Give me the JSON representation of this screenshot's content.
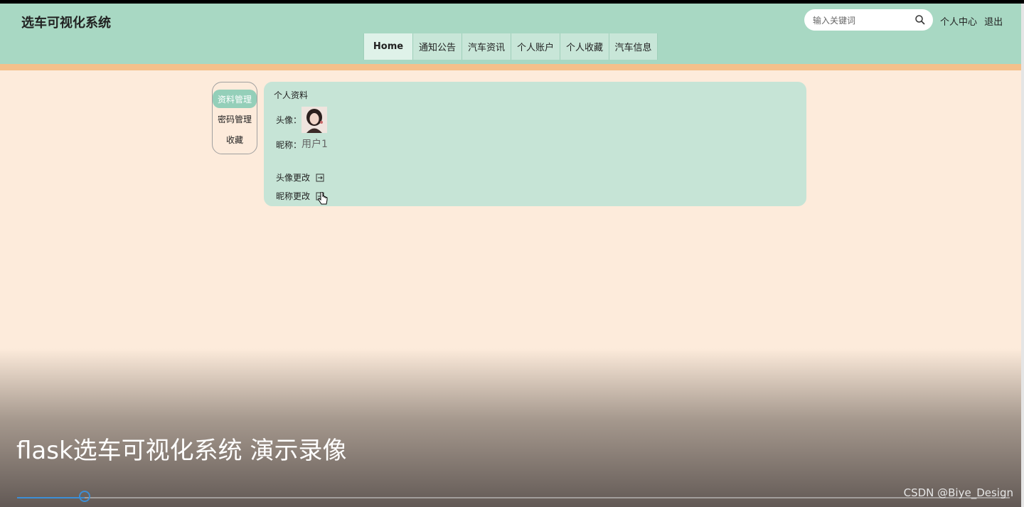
{
  "header": {
    "site_title": "选车可视化系统",
    "search_placeholder": "输入关键词",
    "user_center": "个人中心",
    "logout": "退出"
  },
  "nav": {
    "items": [
      {
        "label": "Home"
      },
      {
        "label": "通知公告"
      },
      {
        "label": "汽车资讯"
      },
      {
        "label": "个人账户"
      },
      {
        "label": "个人收藏"
      },
      {
        "label": "汽车信息"
      }
    ]
  },
  "sidebar": {
    "items": [
      {
        "label": "资料管理"
      },
      {
        "label": "密码管理"
      },
      {
        "label": "收藏"
      }
    ]
  },
  "profile": {
    "title": "个人资料",
    "avatar_label": "头像：",
    "nickname_label": "昵称：",
    "nickname_value": "用户1",
    "change_avatar": "头像更改",
    "change_nickname": "昵称更改"
  },
  "video": {
    "title": "flask选车可视化系统 演示录像",
    "progress_fraction": 0.068,
    "watermark": "CSDN @Biye_Design"
  },
  "colors": {
    "header_bg": "#a8d8c3",
    "accent_bar": "#f4c08b",
    "page_bg": "#fdebdb",
    "card_bg": "#c6e4d6",
    "progress": "#3d8fd6"
  }
}
